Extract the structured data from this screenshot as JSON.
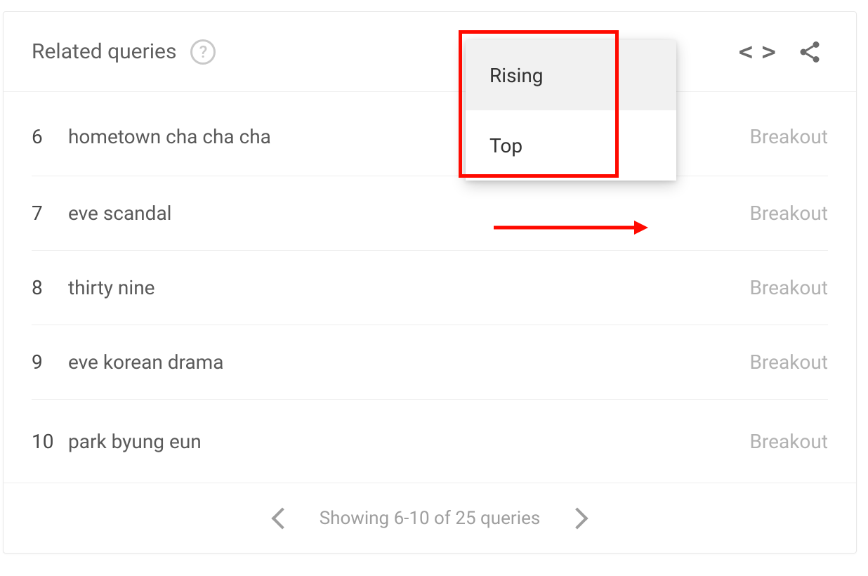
{
  "header": {
    "title": "Related queries",
    "help": "?"
  },
  "sort_menu": {
    "options": [
      "Rising",
      "Top"
    ],
    "selected_index": 0
  },
  "rows": [
    {
      "rank": "6",
      "query": "hometown cha cha cha",
      "metric": "Breakout"
    },
    {
      "rank": "7",
      "query": "eve scandal",
      "metric": "Breakout"
    },
    {
      "rank": "8",
      "query": "thirty nine",
      "metric": "Breakout"
    },
    {
      "rank": "9",
      "query": "eve korean drama",
      "metric": "Breakout"
    },
    {
      "rank": "10",
      "query": "park byung eun",
      "metric": "Breakout"
    }
  ],
  "pagination": {
    "label": "Showing 6-10 of 25 queries"
  },
  "icons": {
    "code_arrows": "< >",
    "share": "share-icon"
  }
}
